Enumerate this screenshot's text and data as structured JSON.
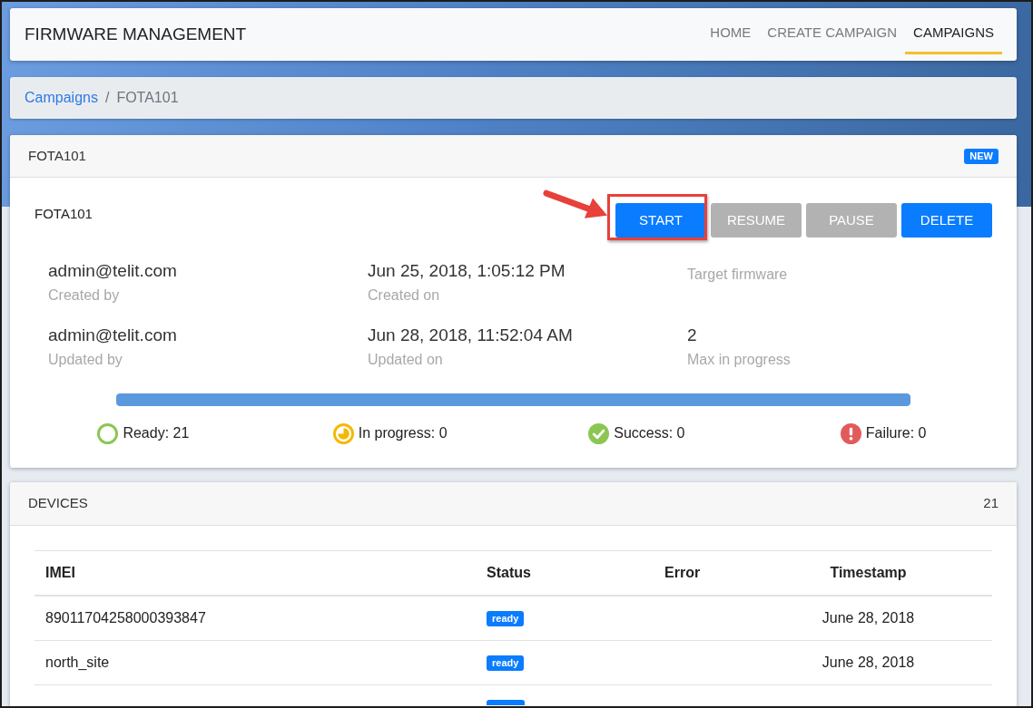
{
  "navbar": {
    "title": "FIRMWARE MANAGEMENT",
    "links": [
      {
        "label": "HOME",
        "selected": false
      },
      {
        "label": "CREATE CAMPAIGN",
        "selected": false
      },
      {
        "label": "CAMPAIGNS",
        "selected": true
      }
    ]
  },
  "breadcrumb": {
    "separator": "/",
    "items": [
      {
        "label": "Campaigns",
        "kind": "link"
      },
      {
        "label": "FOTA101",
        "kind": "current"
      }
    ]
  },
  "campaign": {
    "header": {
      "title": "FOTA101",
      "badge": "NEW"
    },
    "name": "FOTA101",
    "buttons": [
      {
        "label": "START",
        "disabled": false,
        "highlighted": true
      },
      {
        "label": "RESUME",
        "disabled": true,
        "highlighted": false
      },
      {
        "label": "PAUSE",
        "disabled": true,
        "highlighted": false
      },
      {
        "label": "DELETE",
        "disabled": false,
        "highlighted": false
      }
    ],
    "fields": [
      {
        "value": "admin@telit.com",
        "label": "Created by"
      },
      {
        "value": "Jun 25, 2018, 1:05:12 PM",
        "label": "Created on"
      },
      {
        "label": "Target firmware"
      },
      {
        "value": "admin@telit.com",
        "label": "Updated by"
      },
      {
        "value": "Jun 28, 2018, 11:52:04 AM",
        "label": "Updated on"
      },
      {
        "value": "2",
        "label": "Max in progress"
      }
    ],
    "progress": {
      "level": 1
    },
    "stats": [
      {
        "kind": "ready",
        "label": "Ready: 21",
        "color": "#8bc653"
      },
      {
        "kind": "in_progress",
        "label": "In progress: 0",
        "color": "#f5b800"
      },
      {
        "kind": "success",
        "label": "Success: 0",
        "color": "#8bc653"
      },
      {
        "kind": "failure",
        "label": "Failure: 0",
        "color": "#e25b5b"
      }
    ]
  },
  "devices": {
    "title": "DEVICES",
    "count": "21",
    "columns": [
      "IMEI",
      "Status",
      "Error",
      "Timestamp"
    ],
    "rows": [
      {
        "imei": "89011704258000393847",
        "status": "ready",
        "timestamp": "June 28, 2018"
      },
      {
        "imei": "north_site",
        "status": "ready",
        "timestamp": "June 28, 2018"
      }
    ]
  }
}
